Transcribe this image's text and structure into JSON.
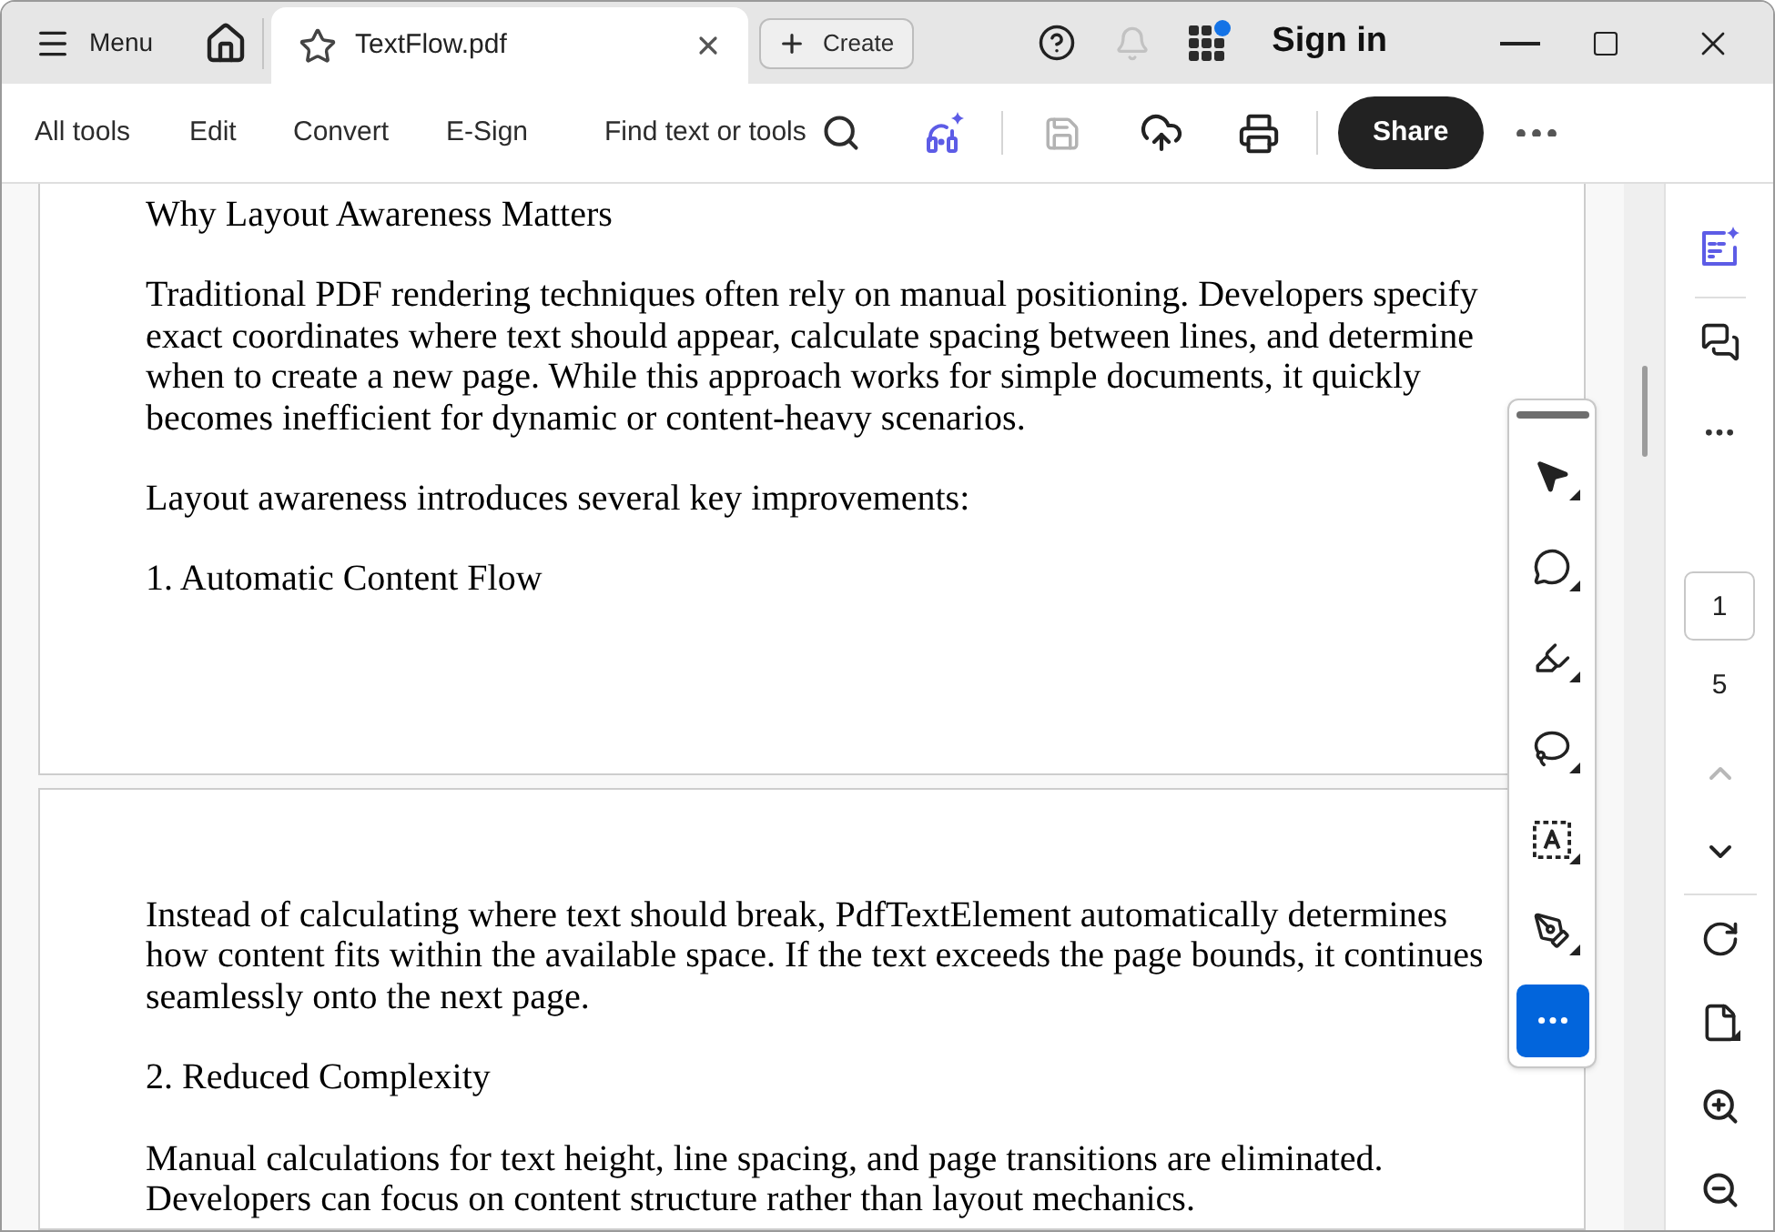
{
  "title_bar": {
    "menu": "Menu",
    "tabs": [
      {
        "title": "TextFlow.pdf",
        "selected": true
      }
    ],
    "create": "Create",
    "notifications_disabled": true,
    "apps_badge": true,
    "sign_in": "Sign in"
  },
  "toolbar": {
    "nav": [
      "All tools",
      "Edit",
      "Convert",
      "E-Sign"
    ],
    "search": "Find text or tools",
    "save_disabled": true,
    "share": "Share"
  },
  "document": {
    "pages": [
      {
        "blocks": [
          "Why Layout Awareness Matters",
          "Traditional PDF rendering techniques often rely on manual positioning. Developers specify exact coordinates where text should appear, calculate spacing between lines, and determine when to create a new page. While this approach works for simple documents, it quickly becomes inefficient for dynamic or content-heavy scenarios.",
          "Layout awareness introduces several key improvements:",
          "1. Automatic Content Flow"
        ]
      },
      {
        "blocks": [
          "Instead of calculating where text should break, PdfTextElement automatically determines how content fits within the available space. If the text exceeds the page bounds, it continues seamlessly onto the next page.",
          "2. Reduced Complexity",
          "Manual calculations for text height, line spacing, and page transitions are eliminated. Developers can focus on content structure rather than layout mechanics."
        ]
      }
    ]
  },
  "tools_panel": {
    "tools": [
      {
        "kind": "select",
        "selected": false
      },
      {
        "kind": "comment",
        "selected": false
      },
      {
        "kind": "highlight",
        "selected": false
      },
      {
        "kind": "draw",
        "selected": false
      },
      {
        "kind": "text-select",
        "selected": false
      },
      {
        "kind": "sign",
        "selected": false
      },
      {
        "kind": "more",
        "selected": true
      }
    ]
  },
  "right_rail": {
    "page_input": "1",
    "page_count": "5",
    "previous_disabled": true,
    "next_disabled": false
  }
}
